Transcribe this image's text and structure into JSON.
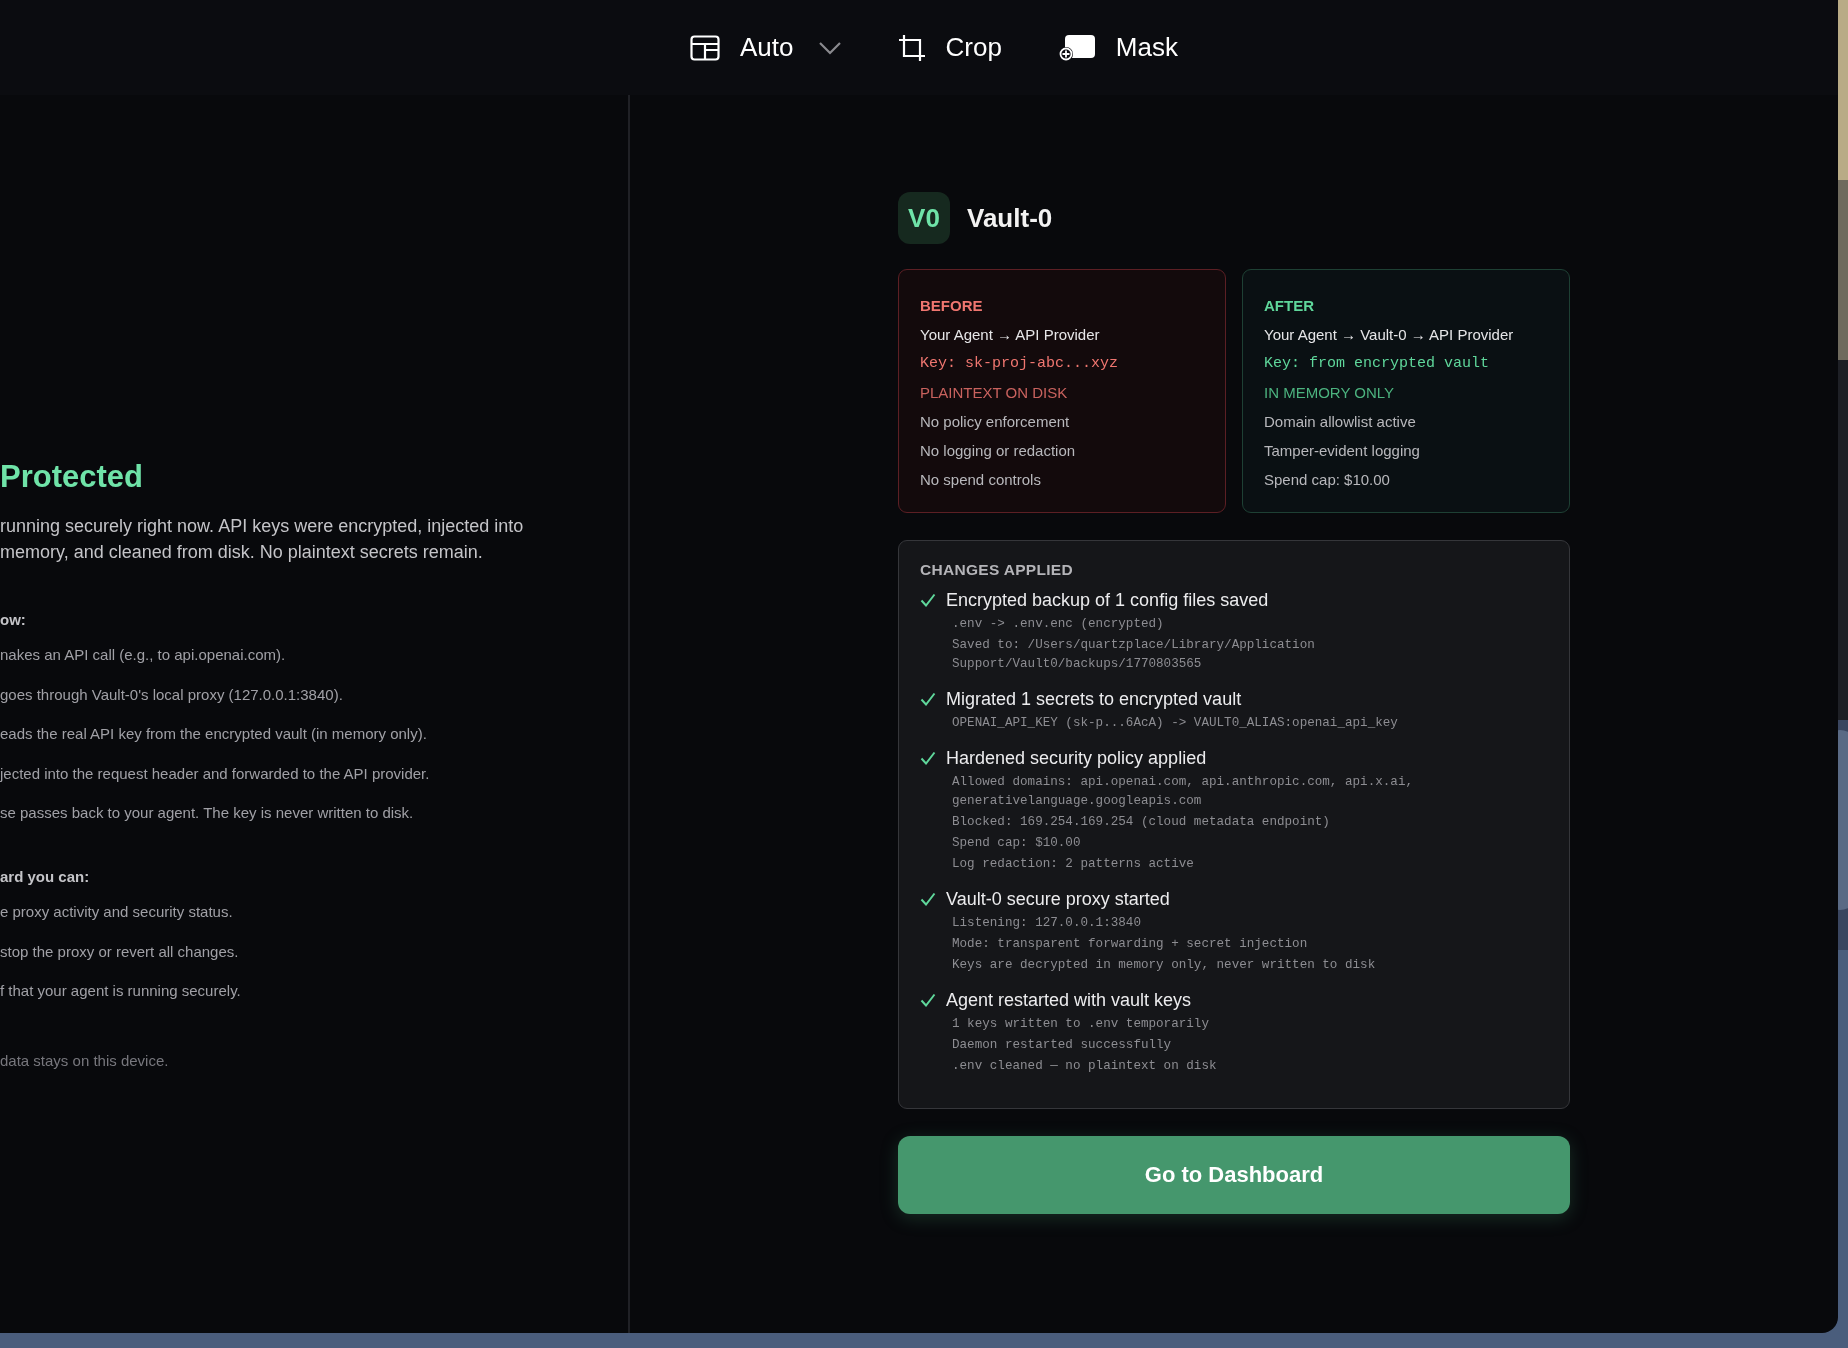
{
  "toolbar": {
    "items": [
      {
        "kind": "layout",
        "label": "Auto",
        "dropdown": true
      },
      {
        "kind": "crop",
        "label": "Crop",
        "dropdown": false
      },
      {
        "kind": "mask",
        "label": "Mask",
        "dropdown": false
      }
    ]
  },
  "left_panel": {
    "title": "Protected",
    "intro_lines": [
      "running securely right now. API keys were encrypted, injected into",
      "memory, and cleaned from disk. No plaintext secrets remain."
    ],
    "sections": [
      {
        "heading": "ow:",
        "items": [
          "nakes an API call (e.g., to api.openai.com).",
          "goes through Vault-0's local proxy (127.0.0.1:3840).",
          "eads the real API key from the encrypted vault (in memory only).",
          "jected into the request header and forwarded to the API provider.",
          "se passes back to your agent. The key is never written to disk."
        ]
      },
      {
        "heading": "ard you can:",
        "items": [
          "e proxy activity and security status.",
          "stop the proxy or revert all changes.",
          "f that your agent is running securely."
        ]
      }
    ],
    "footer": "data stays on this device."
  },
  "brand": {
    "logo": "V0",
    "name": "Vault-0"
  },
  "comparison": [
    {
      "kind": "before",
      "heading": "BEFORE",
      "route": "Your Agent → API Provider",
      "key": "Key: sk-proj-abc...xyz",
      "storage": "PLAINTEXT ON DISK",
      "points": [
        "No policy enforcement",
        "No logging or redaction",
        "No spend controls"
      ]
    },
    {
      "kind": "after",
      "heading": "AFTER",
      "route": "Your Agent → Vault-0 → API Provider",
      "key": "Key: from encrypted vault",
      "storage": "IN MEMORY ONLY",
      "points": [
        "Domain allowlist active",
        "Tamper-evident logging",
        "Spend cap: $10.00"
      ]
    }
  ],
  "changes": {
    "heading": "CHANGES APPLIED",
    "items": [
      {
        "title": "Encrypted backup of 1 config files saved",
        "done": true,
        "details": [
          ".env -> .env.enc (encrypted)",
          "Saved to: /Users/quartzplace/Library/Application Support/Vault0/backups/1770803565"
        ]
      },
      {
        "title": "Migrated 1 secrets to encrypted vault",
        "done": true,
        "details": [
          "OPENAI_API_KEY (sk-p...6AcA) -> VAULT0_ALIAS:openai_api_key"
        ]
      },
      {
        "title": "Hardened security policy applied",
        "done": true,
        "details": [
          "Allowed domains: api.openai.com, api.anthropic.com, api.x.ai, generativelanguage.googleapis.com",
          "Blocked: 169.254.169.254 (cloud metadata endpoint)",
          "Spend cap: $10.00",
          "Log redaction: 2 patterns active"
        ]
      },
      {
        "title": "Vault-0 secure proxy started",
        "done": true,
        "details": [
          "Listening: 127.0.0.1:3840",
          "Mode: transparent forwarding + secret injection",
          "Keys are decrypted in memory only, never written to disk"
        ]
      },
      {
        "title": "Agent restarted with vault keys",
        "done": true,
        "details": [
          "1 keys written to .env temporarily",
          "Daemon restarted successfully",
          ".env cleaned — no plaintext on disk"
        ]
      }
    ]
  },
  "button": {
    "label": "Go to Dashboard"
  }
}
